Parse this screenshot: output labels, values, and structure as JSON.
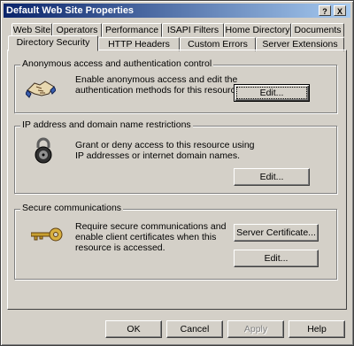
{
  "window": {
    "title": "Default Web Site Properties",
    "help_glyph": "?",
    "close_glyph": "X"
  },
  "tabs_row1": [
    {
      "label": "Web Site"
    },
    {
      "label": "Operators"
    },
    {
      "label": "Performance"
    },
    {
      "label": "ISAPI Filters"
    },
    {
      "label": "Home Directory"
    },
    {
      "label": "Documents"
    }
  ],
  "tabs_row2": [
    {
      "label": "Directory Security",
      "selected": true
    },
    {
      "label": "HTTP Headers"
    },
    {
      "label": "Custom Errors"
    },
    {
      "label": "Server Extensions"
    }
  ],
  "groups": {
    "anonymous": {
      "title": "Anonymous access and authentication control",
      "desc": [
        "Enable anonymous access and edit the",
        "authentication methods for this resource."
      ],
      "edit_label": "Edit...",
      "icon": "handshake-icon"
    },
    "ip": {
      "title": "IP address and domain name restrictions",
      "desc": [
        "Grant or deny access to this resource using",
        "IP addresses or internet domain names."
      ],
      "edit_label": "Edit...",
      "icon": "padlock-icon"
    },
    "secure": {
      "title": "Secure communications",
      "desc": [
        "Require secure communications and",
        "enable client certificates when this",
        "resource is accessed."
      ],
      "cert_label": "Server Certificate...",
      "edit_label": "Edit...",
      "icon": "key-icon"
    }
  },
  "footer": {
    "ok": "OK",
    "cancel": "Cancel",
    "apply": "Apply",
    "help": "Help"
  }
}
